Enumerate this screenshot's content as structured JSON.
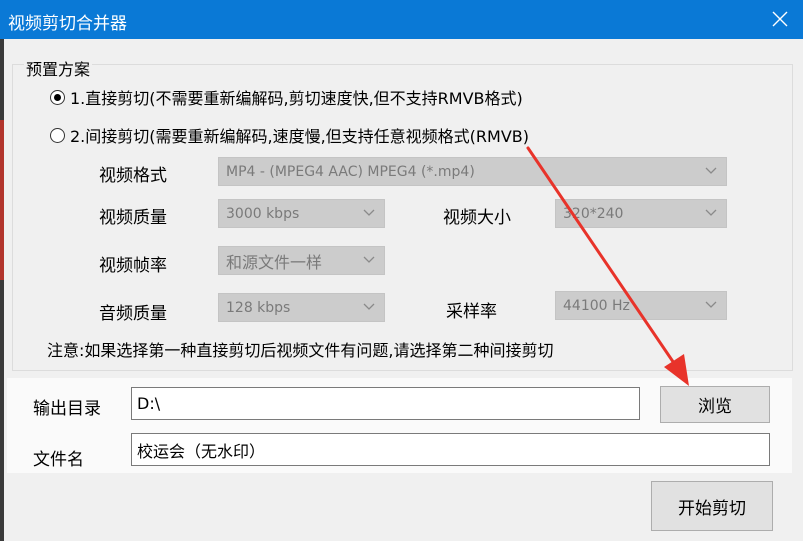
{
  "window": {
    "title": "视频剪切合并器"
  },
  "preset": {
    "legend": "预置方案",
    "option1": "1.直接剪切(不需要重新编解码,剪切速度快,但不支持RMVB格式)",
    "option2": "2.间接剪切(需要重新编解码,速度慢,但支持任意视频格式(RMVB)",
    "selected": 1
  },
  "settings": {
    "video_format_label": "视频格式",
    "video_format_value": "MP4 - (MPEG4 AAC) MPEG4 (*.mp4)",
    "video_quality_label": "视频质量",
    "video_quality_value": "3000 kbps",
    "video_size_label": "视频大小",
    "video_size_value": "320*240",
    "frame_rate_label": "视频帧率",
    "frame_rate_value": "和源文件一样",
    "audio_quality_label": "音频质量",
    "audio_quality_value": "128 kbps",
    "sample_rate_label": "采样率",
    "sample_rate_value": "44100 Hz"
  },
  "note": "注意:如果选择第一种直接剪切后视频文件有问题,请选择第二种间接剪切",
  "output": {
    "dir_label": "输出目录",
    "dir_value": "D:\\",
    "browse_label": "浏览",
    "filename_label": "文件名",
    "filename_value": "校运会（无水印）"
  },
  "actions": {
    "start_label": "开始剪切"
  },
  "colors": {
    "titlebar": "#0a79d6",
    "annotation_arrow": "#e8332a"
  }
}
